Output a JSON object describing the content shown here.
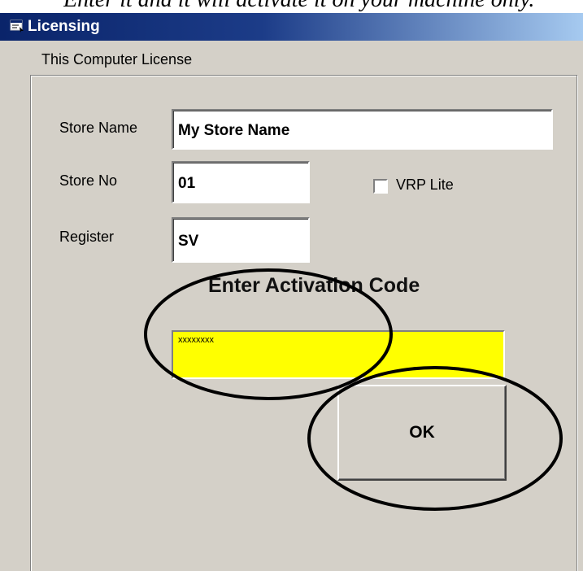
{
  "window": {
    "title": "Licensing"
  },
  "clipped_caption": "Enter it and it will activate it on your machine only.",
  "group": {
    "label": "This Computer License"
  },
  "fields": {
    "store_name": {
      "label": "Store Name",
      "value": "My Store Name"
    },
    "store_no": {
      "label": "Store No",
      "value": "01"
    },
    "register": {
      "label": "Register",
      "value": "SV"
    }
  },
  "vrp_lite": {
    "label": "VRP Lite",
    "checked": false
  },
  "activation": {
    "heading": "Enter Activation Code",
    "value": "xxxxxxxx",
    "bg_color": "#ffff00"
  },
  "ok_button": {
    "label": "OK"
  },
  "colors": {
    "dialog_bg": "#d4d0c8",
    "titlebar": "#0a246a",
    "annotation": "#000000"
  }
}
